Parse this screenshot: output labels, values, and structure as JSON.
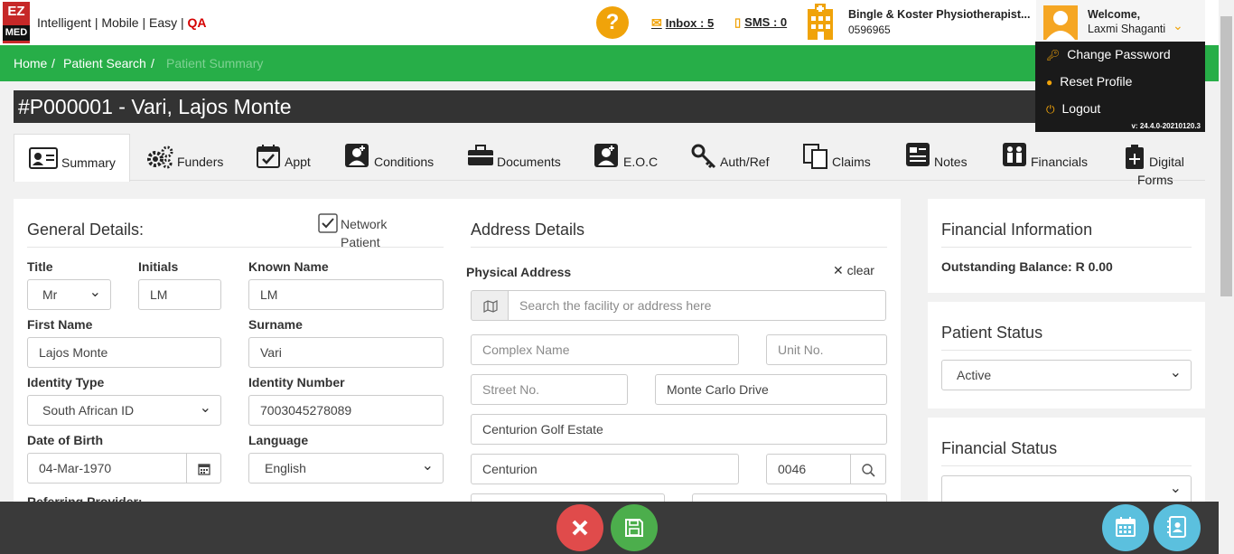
{
  "header": {
    "logo_top": "EZ",
    "logo_bottom": "MED",
    "tagline": "Intelligent | Mobile | Easy | ",
    "tagline_qa": "QA",
    "help": "?",
    "inbox": "Inbox : 5",
    "sms": "SMS : 0",
    "practice_name": "Bingle & Koster Physiotherapist...",
    "practice_number": "0596965",
    "welcome": "Welcome,",
    "user_name": "Laxmi Shaganti"
  },
  "user_menu": {
    "items": [
      "Change Password",
      "Reset Profile",
      "Logout"
    ],
    "version": "v: 24.4.0-20210120.3"
  },
  "breadcrumb": [
    "Home",
    "Patient Search",
    "Patient Summary"
  ],
  "patient_title": "#P000001 - Vari, Lajos Monte",
  "tabs": [
    "Summary",
    "Funders",
    "Appt",
    "Conditions",
    "Documents",
    "E.O.C",
    "Auth/Ref",
    "Claims",
    "Notes",
    "Financials",
    "Digital",
    "Forms"
  ],
  "general": {
    "heading": "General Details:",
    "network_patient": [
      "Network",
      "Patient"
    ],
    "network_patient_checked": true,
    "title_label": "Title",
    "title_value": "Mr",
    "initials_label": "Initials",
    "initials_value": "LM",
    "known_name_label": "Known Name",
    "known_name_value": "LM",
    "first_name_label": "First Name",
    "first_name_value": "Lajos Monte",
    "surname_label": "Surname",
    "surname_value": "Vari",
    "identity_type_label": "Identity Type",
    "identity_type_value": "South African ID",
    "identity_number_label": "Identity Number",
    "identity_number_value": "7003045278089",
    "dob_label": "Date of Birth",
    "dob_value": "04-Mar-1970",
    "language_label": "Language",
    "language_value": "English",
    "referring_label": "Referring Provider:"
  },
  "address": {
    "heading": "Address Details",
    "physical_label": "Physical Address",
    "clear": "clear",
    "search_placeholder": "Search the facility or address here",
    "complex_placeholder": "Complex Name",
    "unit_placeholder": "Unit No.",
    "street_no_placeholder": "Street No.",
    "street_name": "Monte Carlo Drive",
    "suburb": "Centurion Golf Estate",
    "city": "Centurion",
    "postal_code": "0046"
  },
  "financial_info": {
    "heading": "Financial Information",
    "outstanding": "Outstanding Balance: R 0.00"
  },
  "patient_status": {
    "heading": "Patient Status",
    "value": "Active"
  },
  "financial_status": {
    "heading": "Financial Status",
    "value": ""
  },
  "colors": {
    "green": "#27ae48",
    "orange": "#f0a30a",
    "red": "#e04b4b",
    "save_green": "#4cae4c",
    "blue": "#5bc0de"
  }
}
